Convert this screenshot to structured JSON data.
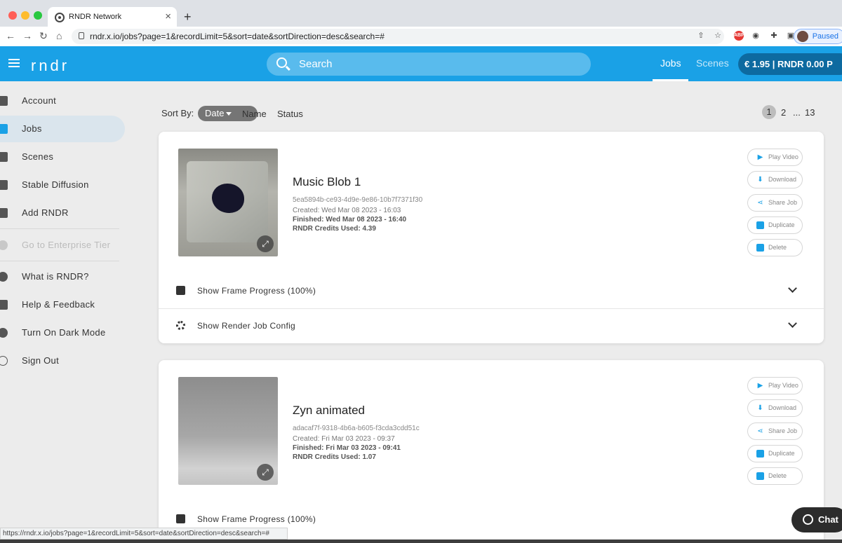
{
  "browser": {
    "tab_title": "RNDR Network",
    "tab_close": "×",
    "new_tab": "+",
    "back": "←",
    "forward": "→",
    "reload": "↻",
    "home": "⌂",
    "url": "rndr.x.io/jobs?page=1&recordLimit=5&sort=date&sortDirection=desc&search=#",
    "abp_label": "ABP",
    "profile_status": "Paused",
    "status_url": "https://rndr.x.io/jobs?page=1&recordLimit=5&sort=date&sortDirection=desc&search=#"
  },
  "header": {
    "logo": "rndr",
    "search_placeholder": "Search",
    "nav_jobs": "Jobs",
    "nav_scenes": "Scenes",
    "balance": "€ 1.95 | RNDR 0.00  P"
  },
  "sidebar": {
    "items": [
      {
        "label": "Account"
      },
      {
        "label": "Jobs"
      },
      {
        "label": "Scenes"
      },
      {
        "label": "Stable Diffusion"
      },
      {
        "label": "Add RNDR"
      },
      {
        "label": "Go to Enterprise Tier"
      },
      {
        "label": "What is RNDR?"
      },
      {
        "label": "Help & Feedback"
      },
      {
        "label": "Turn On Dark Mode"
      },
      {
        "label": "Sign Out"
      }
    ]
  },
  "sort": {
    "label": "Sort By:",
    "selected": "Date",
    "options": [
      "Name",
      "Status"
    ]
  },
  "pagination": {
    "current": "1",
    "next": "2",
    "ellipsis": "...",
    "last": "13"
  },
  "actions": {
    "play": "Play Video",
    "download": "Download",
    "share": "Share Job",
    "duplicate": "Duplicate",
    "delete": "Delete"
  },
  "jobs": [
    {
      "title": "Music Blob 1",
      "id": "5ea5894b-ce93-4d9e-9e86-10b7f7371f30",
      "created": "Created: Wed Mar 08 2023 - 16:03",
      "finished": "Finished: Wed Mar 08 2023 - 16:40",
      "credits": "RNDR Credits Used: 4.39",
      "frame_progress": "Show Frame Progress (100%)",
      "render_config": "Show Render Job Config"
    },
    {
      "title": "Zyn animated",
      "id": "adacaf7f-9318-4b6a-b605-f3cda3cdd51c",
      "created": "Created: Fri Mar 03 2023 - 09:37",
      "finished": "Finished: Fri Mar 03 2023 - 09:41",
      "credits": "RNDR Credits Used: 1.07",
      "frame_progress": "Show Frame Progress (100%)"
    }
  ],
  "chat": {
    "label": "Chat"
  },
  "colors": {
    "accent": "#1aa1e6",
    "balance_bg": "#0d6aa0"
  }
}
